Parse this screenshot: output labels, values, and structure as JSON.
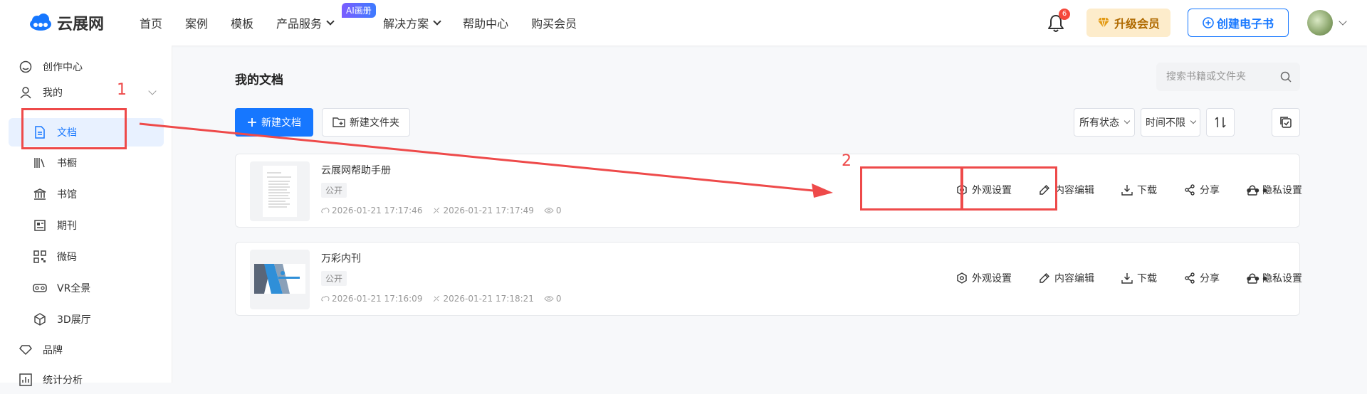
{
  "header": {
    "logo_text": "云展网",
    "nav": [
      {
        "label": "首页"
      },
      {
        "label": "案例"
      },
      {
        "label": "模板"
      },
      {
        "label": "产品服务"
      },
      {
        "label": "解决方案"
      },
      {
        "label": "帮助中心"
      },
      {
        "label": "购买会员"
      }
    ],
    "ai_badge": "AI画册",
    "notification_count": "6",
    "vip_label": "升级会员",
    "create_label": "创建电子书"
  },
  "sidebar": {
    "items": [
      {
        "label": "创作中心",
        "icon": "home-icon"
      },
      {
        "label": "我的",
        "icon": "user-icon"
      },
      {
        "label": "文档",
        "icon": "document-icon"
      },
      {
        "label": "书橱",
        "icon": "bookshelf-icon"
      },
      {
        "label": "书馆",
        "icon": "library-icon"
      },
      {
        "label": "期刊",
        "icon": "journal-icon"
      },
      {
        "label": "微码",
        "icon": "qrcode-icon"
      },
      {
        "label": "VR全景",
        "icon": "vr-icon"
      },
      {
        "label": "3D展厅",
        "icon": "cube-icon"
      },
      {
        "label": "品牌",
        "icon": "diamond-icon"
      },
      {
        "label": "统计分析",
        "icon": "chart-icon"
      }
    ]
  },
  "main": {
    "title": "我的文档",
    "search_placeholder": "搜索书籍或文件夹",
    "new_doc_label": "新建文档",
    "new_folder_label": "新建文件夹",
    "status_filter": "所有状态",
    "time_filter": "时间不限",
    "documents": [
      {
        "title": "云展网帮助手册",
        "visibility": "公开",
        "created": "2026-01-21 17:17:46",
        "updated": "2026-01-21 17:17:49",
        "views": "0"
      },
      {
        "title": "万彩内刊",
        "visibility": "公开",
        "created": "2026-01-21 17:16:09",
        "updated": "2026-01-21 17:18:21",
        "views": "0"
      }
    ],
    "actions": {
      "appearance": "外观设置",
      "edit_content": "内容编辑",
      "download": "下载",
      "share": "分享",
      "privacy": "隐私设置",
      "more": "•••"
    }
  },
  "annotations": {
    "label_1": "1",
    "label_2": "2",
    "color": "#ee4a4a"
  }
}
